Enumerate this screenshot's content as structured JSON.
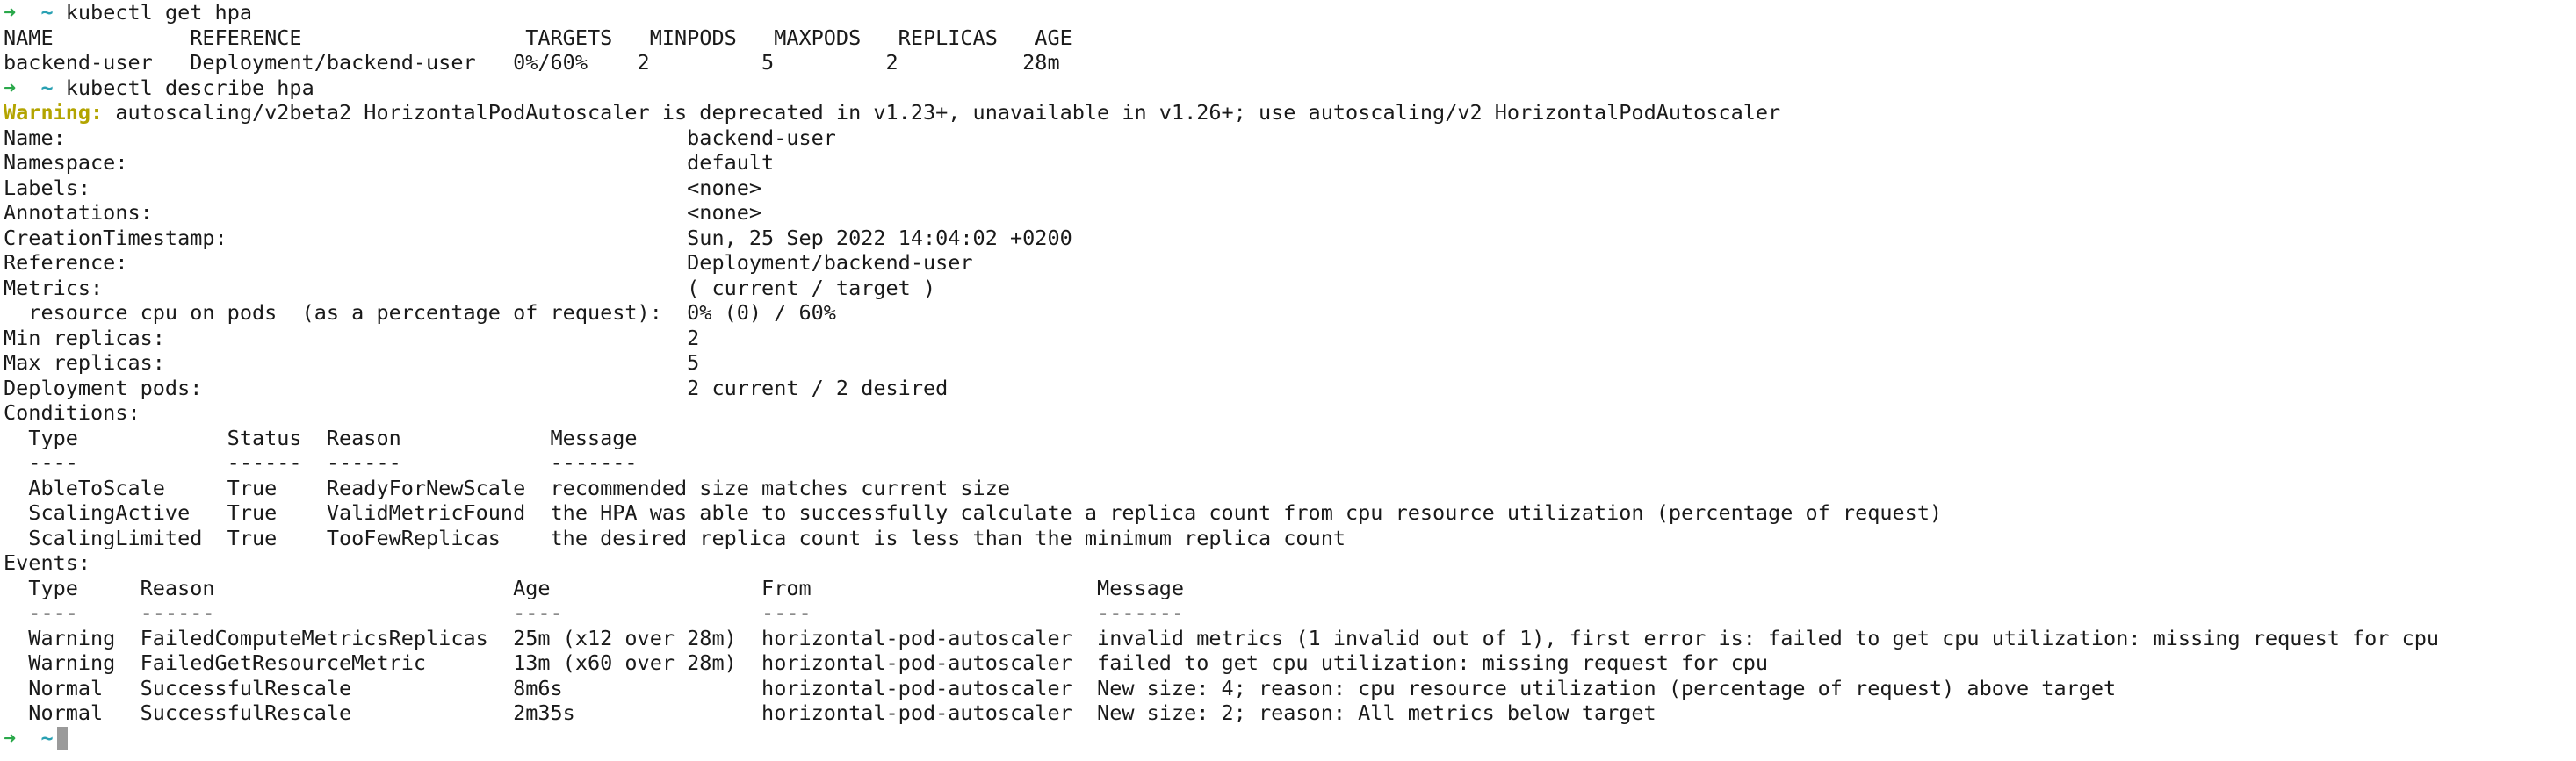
{
  "prompt": {
    "arrow": "➜",
    "dir": "~"
  },
  "commands": {
    "get_hpa": "kubectl get hpa",
    "describe_hpa": "kubectl describe hpa"
  },
  "get_hpa_table": {
    "header": "NAME           REFERENCE                  TARGETS   MINPODS   MAXPODS   REPLICAS   AGE",
    "rows": [
      "backend-user   Deployment/backend-user   0%/60%    2         5         2          28m"
    ]
  },
  "warning": {
    "label": "Warning:",
    "text": " autoscaling/v2beta2 HorizontalPodAutoscaler is deprecated in v1.23+, unavailable in v1.26+; use autoscaling/v2 HorizontalPodAutoscaler"
  },
  "describe_lines": [
    "Name:                                                  backend-user",
    "Namespace:                                             default",
    "Labels:                                                <none>",
    "Annotations:                                           <none>",
    "CreationTimestamp:                                     Sun, 25 Sep 2022 14:04:02 +0200",
    "Reference:                                             Deployment/backend-user",
    "Metrics:                                               ( current / target )",
    "  resource cpu on pods  (as a percentage of request):  0% (0) / 60%",
    "Min replicas:                                          2",
    "Max replicas:                                          5",
    "Deployment pods:                                       2 current / 2 desired",
    "Conditions:",
    "  Type            Status  Reason            Message",
    "  ----            ------  ------            -------",
    "  AbleToScale     True    ReadyForNewScale  recommended size matches current size",
    "  ScalingActive   True    ValidMetricFound  the HPA was able to successfully calculate a replica count from cpu resource utilization (percentage of request)",
    "  ScalingLimited  True    TooFewReplicas    the desired replica count is less than the minimum replica count",
    "Events:",
    "  Type     Reason                        Age                 From                       Message",
    "  ----     ------                        ----                ----                       -------",
    "  Warning  FailedComputeMetricsReplicas  25m (x12 over 28m)  horizontal-pod-autoscaler  invalid metrics (1 invalid out of 1), first error is: failed to get cpu utilization: missing request for cpu",
    "  Warning  FailedGetResourceMetric       13m (x60 over 28m)  horizontal-pod-autoscaler  failed to get cpu utilization: missing request for cpu",
    "  Normal   SuccessfulRescale             8m6s                horizontal-pod-autoscaler  New size: 4; reason: cpu resource utilization (percentage of request) above target",
    "  Normal   SuccessfulRescale             2m35s               horizontal-pod-autoscaler  New size: 2; reason: All metrics below target"
  ],
  "colors": {
    "background": "#ffffff",
    "text": "#1a1a1a",
    "prompt_arrow": "#2aa84a",
    "prompt_dir": "#2aa1b3",
    "warning_label": "#b3a400",
    "cursor": "#9a9a9a"
  }
}
